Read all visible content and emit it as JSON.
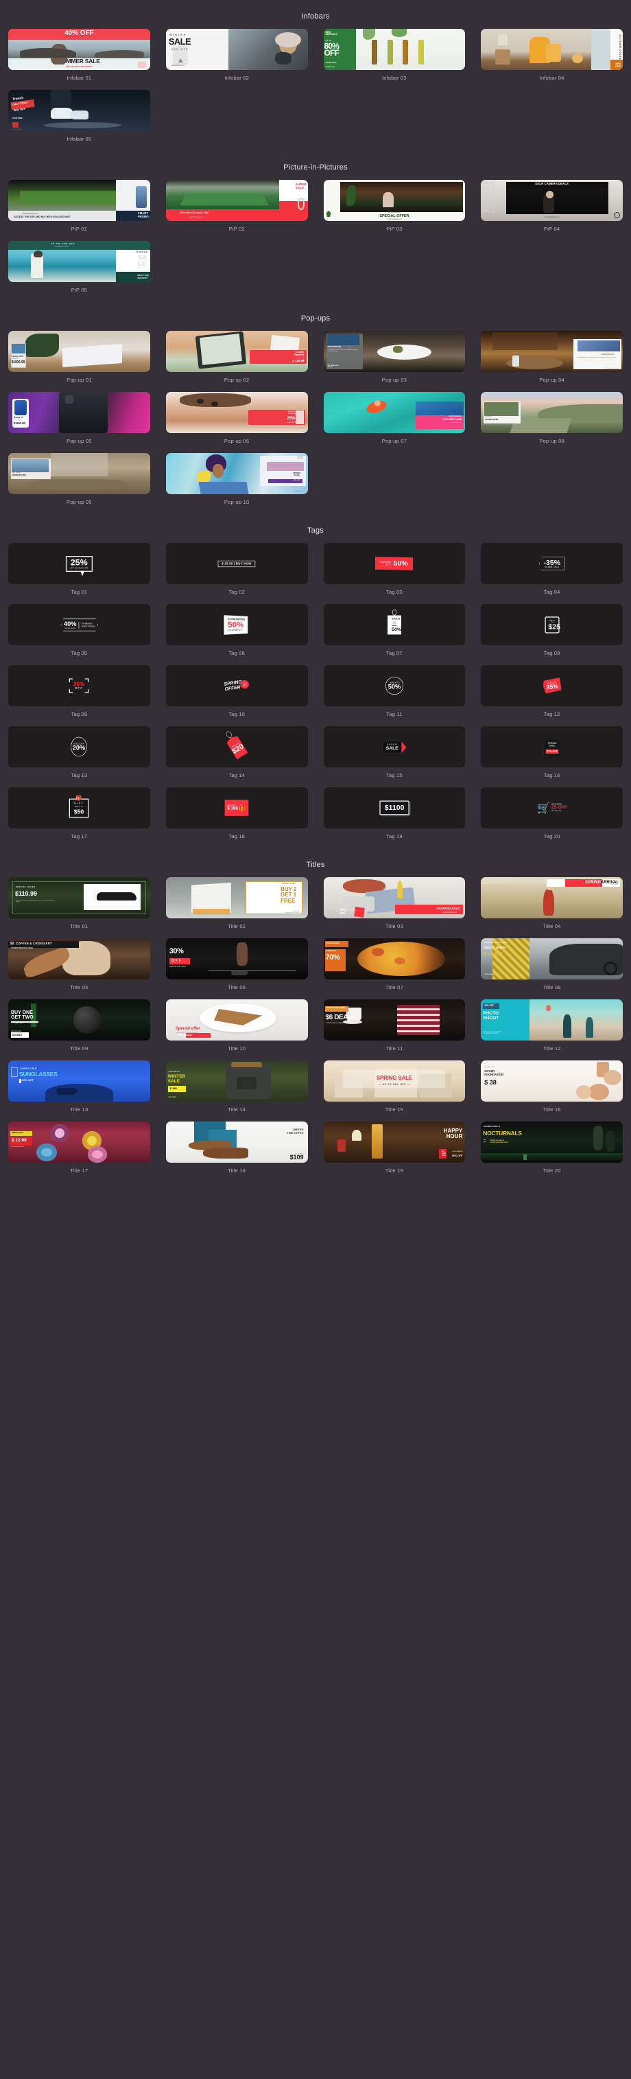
{
  "theme": {
    "background": "#352f38",
    "card_dark": "#1e1c1d",
    "accent_red": "#f6323f",
    "caption_color": "#b9b2bd",
    "title_color": "#e9e6ec"
  },
  "sections": [
    {
      "id": "infobars",
      "title": "Infobars",
      "items": [
        {
          "caption": "Infobar 01",
          "art": "infobar01",
          "texts": [
            "40% OFF",
            "SUMMER SALE",
            "40% OFF ON EVERYTHING",
            "YOUR LOGO"
          ]
        },
        {
          "caption": "Infobar 02",
          "art": "infobar02",
          "texts": [
            "WINTER",
            "SALE",
            "40% OFF",
            "your website.com"
          ]
        },
        {
          "caption": "Infobar 03",
          "art": "infobar03",
          "texts": [
            "NEW ARRIVALS",
            "UP TO",
            "80% OFF",
            "YOUR LOGO",
            "yoursite.com"
          ]
        },
        {
          "caption": "Infobar 04",
          "art": "infobar04",
          "texts": [
            "AUTUMN COLLECTION",
            "30% OFF"
          ]
        },
        {
          "caption": "Infobar 05",
          "art": "infobar05",
          "texts": [
            "Trends",
            "ONLY TODAY",
            "30% OFF",
            "SHOP NOW",
            "YOUR LOGO"
          ]
        }
      ]
    },
    {
      "id": "pips",
      "title": "Picture-in-Pictures",
      "items": [
        {
          "caption": "PiP 01",
          "art": "pip01",
          "texts": [
            "SMARTPHONE.COM",
            "ACCESS THE SITE AND BUY WITH 20% DISCOUNT",
            "SMART PROMO",
            "YOUR LOGO"
          ]
        },
        {
          "caption": "PiP 02",
          "art": "pip02",
          "texts": [
            "SUPER SALE",
            "25% off until march 15th",
            "SMARTPHONE.COM",
            "YOUR LOGO"
          ]
        },
        {
          "caption": "PiP 03",
          "art": "pip03",
          "texts": [
            "UP TO 50% OFF",
            "SPECIAL OFFER",
            "YOURGARDEN.COM",
            "YOUR LOGO"
          ]
        },
        {
          "caption": "PiP 04",
          "art": "pip04",
          "texts": [
            "SALE",
            "DSLR CAMERA DEALS",
            "YOURCAMERA.COM",
            "YOUR LOGO"
          ]
        },
        {
          "caption": "PiP 05",
          "art": "pip05",
          "texts": [
            "UP TO 40% OFF",
            "SUMMERSALE.COM",
            "SUMMER",
            "SALE",
            "ENJOY OUR DISCOUNT"
          ]
        }
      ]
    },
    {
      "id": "popups",
      "title": "Pop-ups",
      "items": [
        {
          "caption": "Pop-up 01",
          "art": "pop01",
          "texts": [
            "Laptop XPS",
            "starting at",
            "$ 800.99",
            "On laptop.com"
          ]
        },
        {
          "caption": "Pop-up 02",
          "art": "pop02",
          "texts": [
            "E-reader PaperKite",
            "Today only",
            "$ 148.99"
          ]
        },
        {
          "caption": "Pop-up 03",
          "art": "pop03",
          "texts": [
            "THE DISHWATER",
            "Seafood, pastas and a furious farm united are the deals we sell at first goal",
            "GET TODAY ONLY 15% OFF"
          ]
        },
        {
          "caption": "Pop-up 04",
          "art": "pop04",
          "texts": [
            "Lafond Winery",
            "Large limited offer on our range of fine wines in spirits with set wide storage",
            "2891 Central Ave, Los Angeles"
          ]
        },
        {
          "caption": "Pop-up 05",
          "art": "pop05",
          "texts": [
            "iPhone 12",
            "Buy from first",
            "$ 940.00"
          ]
        },
        {
          "caption": "Pop-up 06",
          "art": "pop06",
          "texts": [
            "ENJOY OUR DISCOUNT",
            "25%",
            "DON'T MISS OUR OFFER"
          ]
        },
        {
          "caption": "Pop-up 07",
          "art": "pop07",
          "texts": [
            "VACATION RENTALS",
            "COCONUT CLUB",
            "coconutrentals.com"
          ]
        },
        {
          "caption": "Pop-up 08",
          "art": "pop08",
          "texts": [
            "Discover our",
            "SPORTS GEAR"
          ]
        },
        {
          "caption": "Pop-up 09",
          "art": "pop09",
          "texts": [
            "MEET THE NEW",
            "PHANTOM 4 PRO"
          ]
        },
        {
          "caption": "Pop-up 10",
          "art": "pop10",
          "texts": [
            "GET THE LOOK TWICE",
            "SPRING SALE",
            "50% OFF",
            "springsale.com"
          ]
        }
      ]
    },
    {
      "id": "tags",
      "title": "Tags",
      "items": [
        {
          "caption": "Tag 01",
          "glyph": "speech-25",
          "main": "25%",
          "sub": "OFF ON OUR SITE",
          "style": "outline"
        },
        {
          "caption": "Tag 02",
          "glyph": "pill-price",
          "main": "$ 15.99 | BUY NOW",
          "sub": "",
          "style": "outline-small"
        },
        {
          "caption": "Tag 03",
          "glyph": "ribbon-50",
          "main": "50%",
          "sub": "DISCOUNT UP TO",
          "style": "red"
        },
        {
          "caption": "Tag 04",
          "glyph": "tag-35",
          "main": "-35%",
          "sub": "SUPER SALE",
          "style": "outline"
        },
        {
          "caption": "Tag 05",
          "glyph": "ticket-40",
          "main": "40%",
          "sub": "TOP BRANDS LATEST TRENDS",
          "style": "outline"
        },
        {
          "caption": "Tag 06",
          "glyph": "card-50",
          "main": "50%",
          "sub": "GUARANTEED CASHBACK",
          "style": "white"
        },
        {
          "caption": "Tag 07",
          "glyph": "hangtag-50",
          "main": "50%",
          "sub": "SALE SAVE UP TO",
          "style": "white"
        },
        {
          "caption": "Tag 08",
          "glyph": "phone-25",
          "main": "$25",
          "sub": "SAVE UP TO",
          "style": "outline"
        },
        {
          "caption": "Tag 09",
          "glyph": "bracket-25",
          "main": "25%",
          "sub": "OFF",
          "style": "red"
        },
        {
          "caption": "Tag 10",
          "glyph": "spring-offer",
          "main": "SPRING OFFER",
          "sub": "25% OFF",
          "style": "mixed"
        },
        {
          "caption": "Tag 11",
          "glyph": "badge-50",
          "main": "50%",
          "sub": "SAVE UP TO",
          "style": "outline"
        },
        {
          "caption": "Tag 12",
          "glyph": "burst-35",
          "main": "35%",
          "sub": "SAVE UP TO",
          "style": "red"
        },
        {
          "caption": "Tag 13",
          "glyph": "oval-20",
          "main": "20%",
          "sub": "DISCOUNT",
          "style": "outline"
        },
        {
          "caption": "Tag 14",
          "glyph": "hangtag-20",
          "main": "$20",
          "sub": "SAVE UP TO",
          "style": "red"
        },
        {
          "caption": "Tag 15",
          "glyph": "arrow-supersale",
          "main": "SUPER SALE",
          "sub": "",
          "style": "mixed"
        },
        {
          "caption": "Tag 16",
          "glyph": "spring-sale",
          "main": "SPRING SALE",
          "sub": "25% OFF",
          "style": "mixed"
        },
        {
          "caption": "Tag 17",
          "glyph": "gift-50",
          "main": "$50",
          "sub": "GIFT SAVE UP TO",
          "style": "outline"
        },
        {
          "caption": "Tag 18",
          "glyph": "giftcard-100",
          "main": "$ 100",
          "sub": "GIFT CARD",
          "style": "red"
        },
        {
          "caption": "Tag 19",
          "glyph": "label-1100",
          "main": "$1100",
          "sub": "",
          "style": "white"
        },
        {
          "caption": "Tag 20",
          "glyph": "cart-coupon",
          "main": "25 OFF",
          "sub": "USE COUPON ON CHECKOUT",
          "style": "mixed"
        }
      ]
    },
    {
      "id": "titles",
      "title": "Titles",
      "items": [
        {
          "caption": "Title 01",
          "art": "title01",
          "texts": [
            "SPECIAL OFFER",
            "$110.99",
            "Looks fast and feels secure. Engineered mesh, a heel overlay and dynamic support."
          ]
        },
        {
          "caption": "Title 02",
          "art": "title02",
          "texts": [
            "HOLIDAY OFFER",
            "BUY 2 GET 1 FREE",
            "Tasting notes: Floral, Sweet, Apple, Chocolate"
          ]
        },
        {
          "caption": "Title 03",
          "art": "title03",
          "texts": [
            "25% OFF",
            "FASHION SALE",
            "HAND-PICKED DEALS"
          ]
        },
        {
          "caption": "Title 04",
          "art": "title04",
          "texts": [
            "SPRING ARRIVAL",
            "SHOP NOW"
          ]
        },
        {
          "caption": "Title 05",
          "art": "title05",
          "texts": [
            "$2",
            "COFFEE & CROISSANT",
            "STUDENT DISCOUNT WEEK"
          ]
        },
        {
          "caption": "Title 06",
          "art": "title06",
          "texts": [
            "30%",
            "OFF",
            "JOIN OUR GYM TODAY"
          ]
        },
        {
          "caption": "Title 07",
          "art": "title07",
          "texts": [
            "ITALIAN PIZZA",
            "SAVE UP TO",
            "70%"
          ]
        },
        {
          "caption": "Title 08",
          "art": "title08",
          "texts": [
            "ADRENALINE ON TWO WHEELS",
            "BMW S 1000 R",
            "$ 14.995",
            "1 YEAR WARRANTY"
          ]
        },
        {
          "caption": "Title 09",
          "art": "title09",
          "texts": [
            "BUY ONE GET TWO",
            "TODAY ONLY",
            "USE THE CODE",
            "DOUBLE"
          ]
        },
        {
          "caption": "Title 10",
          "art": "title10",
          "texts": [
            "TASTY WEEKEND",
            "Special offer",
            "50% OFF ON YOUR SECOND PIE"
          ]
        },
        {
          "caption": "Title 11",
          "art": "title11",
          "texts": [
            "COME TRY OUR CAKES",
            "$6 DEAL",
            "CAKE SLICE & COFFEE"
          ]
        },
        {
          "caption": "Title 12",
          "art": "title12",
          "texts": [
            "30% OFF",
            "PHOTO SHOOT",
            "SAVE A LOT ON PHOTO PRODUCTION",
            "FOR A PRIVATE PHOTOGRAPHY"
          ]
        },
        {
          "caption": "Title 13",
          "art": "title13",
          "texts": [
            "AWESOME",
            "SUNGLASSES",
            "25% OFF"
          ]
        },
        {
          "caption": "Title 14",
          "art": "title14",
          "texts": [
            "DON'T MISS OUT",
            "WINTER SALE",
            "$ 198",
            "PRE-ORDER"
          ]
        },
        {
          "caption": "Title 15",
          "art": "title15",
          "texts": [
            "SPRING SALE",
            "UP TO 50% OFF"
          ]
        },
        {
          "caption": "Title 16",
          "art": "title16",
          "texts": [
            "SPECIAL OFFER",
            "COVER FOUNDATION",
            "$ 38"
          ]
        },
        {
          "caption": "Title 17",
          "art": "title17",
          "texts": [
            "MIXED BOX",
            "$ 12.99",
            "for a 6 donut mixed box"
          ]
        },
        {
          "caption": "Title 18",
          "art": "title18",
          "texts": [
            "LIMITED TIME OFFER",
            "Get it now for",
            "$109"
          ]
        },
        {
          "caption": "Title 19",
          "art": "title19",
          "texts": [
            "HAPPY HOUR",
            "27 NOV TUE",
            "ALL COCKTAILS",
            "50% OFF"
          ]
        },
        {
          "caption": "Title 20",
          "art": "title20",
          "texts": [
            "SATURDAY APRIL 22",
            "NOCTURNALS",
            "10 pm",
            "tickets on sale at",
            "nocturnaltickets.com"
          ]
        }
      ]
    }
  ]
}
